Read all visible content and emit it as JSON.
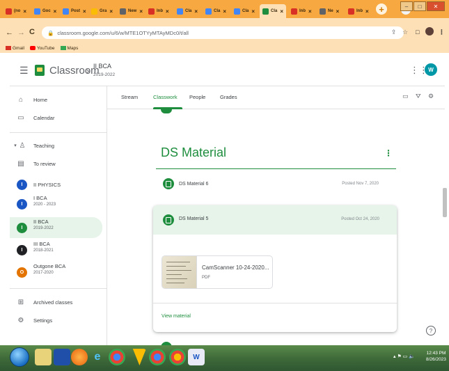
{
  "browser": {
    "tabs": [
      {
        "label": "(no",
        "icon": "gmail-icon",
        "color": "#d93025"
      },
      {
        "label": "Goc",
        "icon": "docs-icon",
        "color": "#4285f4"
      },
      {
        "label": "Post",
        "icon": "post-icon",
        "color": "#4285f4"
      },
      {
        "label": "Gra",
        "icon": "slides-icon",
        "color": "#fbbc04"
      },
      {
        "label": "New",
        "icon": "chrome-icon",
        "color": "#5f6368"
      },
      {
        "label": "Inb",
        "icon": "gmail-icon",
        "color": "#d93025"
      },
      {
        "label": "Cla",
        "icon": "classroom-icon",
        "color": "#4285f4"
      },
      {
        "label": "Cla",
        "icon": "classroom-icon",
        "color": "#4285f4"
      },
      {
        "label": "Cla",
        "icon": "classroom-icon",
        "color": "#4285f4"
      },
      {
        "label": "Cla",
        "icon": "classroom-icon",
        "color": "#1e8e3e",
        "active": true
      },
      {
        "label": "Inb",
        "icon": "gmail-icon",
        "color": "#d93025"
      },
      {
        "label": "Ne",
        "icon": "chrome-icon",
        "color": "#5f6368"
      },
      {
        "label": "Inb",
        "icon": "gmail-icon",
        "color": "#d93025"
      }
    ],
    "new_tab": "+",
    "url": "classroom.google.com/u/6/w/MTE1OTYyMTAyMDc0/t/all",
    "bookmarks": [
      {
        "label": "Gmail",
        "color": "#d93025"
      },
      {
        "label": "YouTube",
        "color": "#ff0000"
      },
      {
        "label": "Maps",
        "color": "#34a853"
      }
    ]
  },
  "header": {
    "app_name": "Classroom",
    "class_title": "II BCA",
    "class_subtitle": "2019-2022",
    "avatar_letter": "W"
  },
  "sidebar": {
    "home": "Home",
    "calendar": "Calendar",
    "teaching": "Teaching",
    "to_review": "To review",
    "classes": [
      {
        "name": "II PHYSICS",
        "sub": "",
        "letter": "I",
        "color": "#1a56c4"
      },
      {
        "name": "I BCA",
        "sub": "2020 - 2023",
        "letter": "I",
        "color": "#1a56c4"
      },
      {
        "name": "II BCA",
        "sub": "2019-2022",
        "letter": "I",
        "color": "#1e8e3e",
        "selected": true
      },
      {
        "name": "III BCA",
        "sub": "2018-2021",
        "letter": "I",
        "color": "#202124"
      },
      {
        "name": "Outgone BCA",
        "sub": "2017-2020",
        "letter": "O",
        "color": "#e37400"
      }
    ],
    "archived": "Archived classes",
    "settings": "Settings"
  },
  "tabs": {
    "stream": "Stream",
    "classwork": "Classwork",
    "people": "People",
    "grades": "Grades"
  },
  "main": {
    "topic_title": "DS Material",
    "materials": [
      {
        "title": "DS Material 6",
        "date": "Posted Nov 7, 2020"
      },
      {
        "title": "DS Material 5",
        "date": "Posted Oct 24, 2020"
      }
    ],
    "attachment": {
      "title": "CamScanner 10-24-2020...",
      "type": "PDF"
    },
    "view_material": "View material"
  },
  "taskbar": {
    "time": "12:43 PM",
    "date": "8/26/2023"
  }
}
